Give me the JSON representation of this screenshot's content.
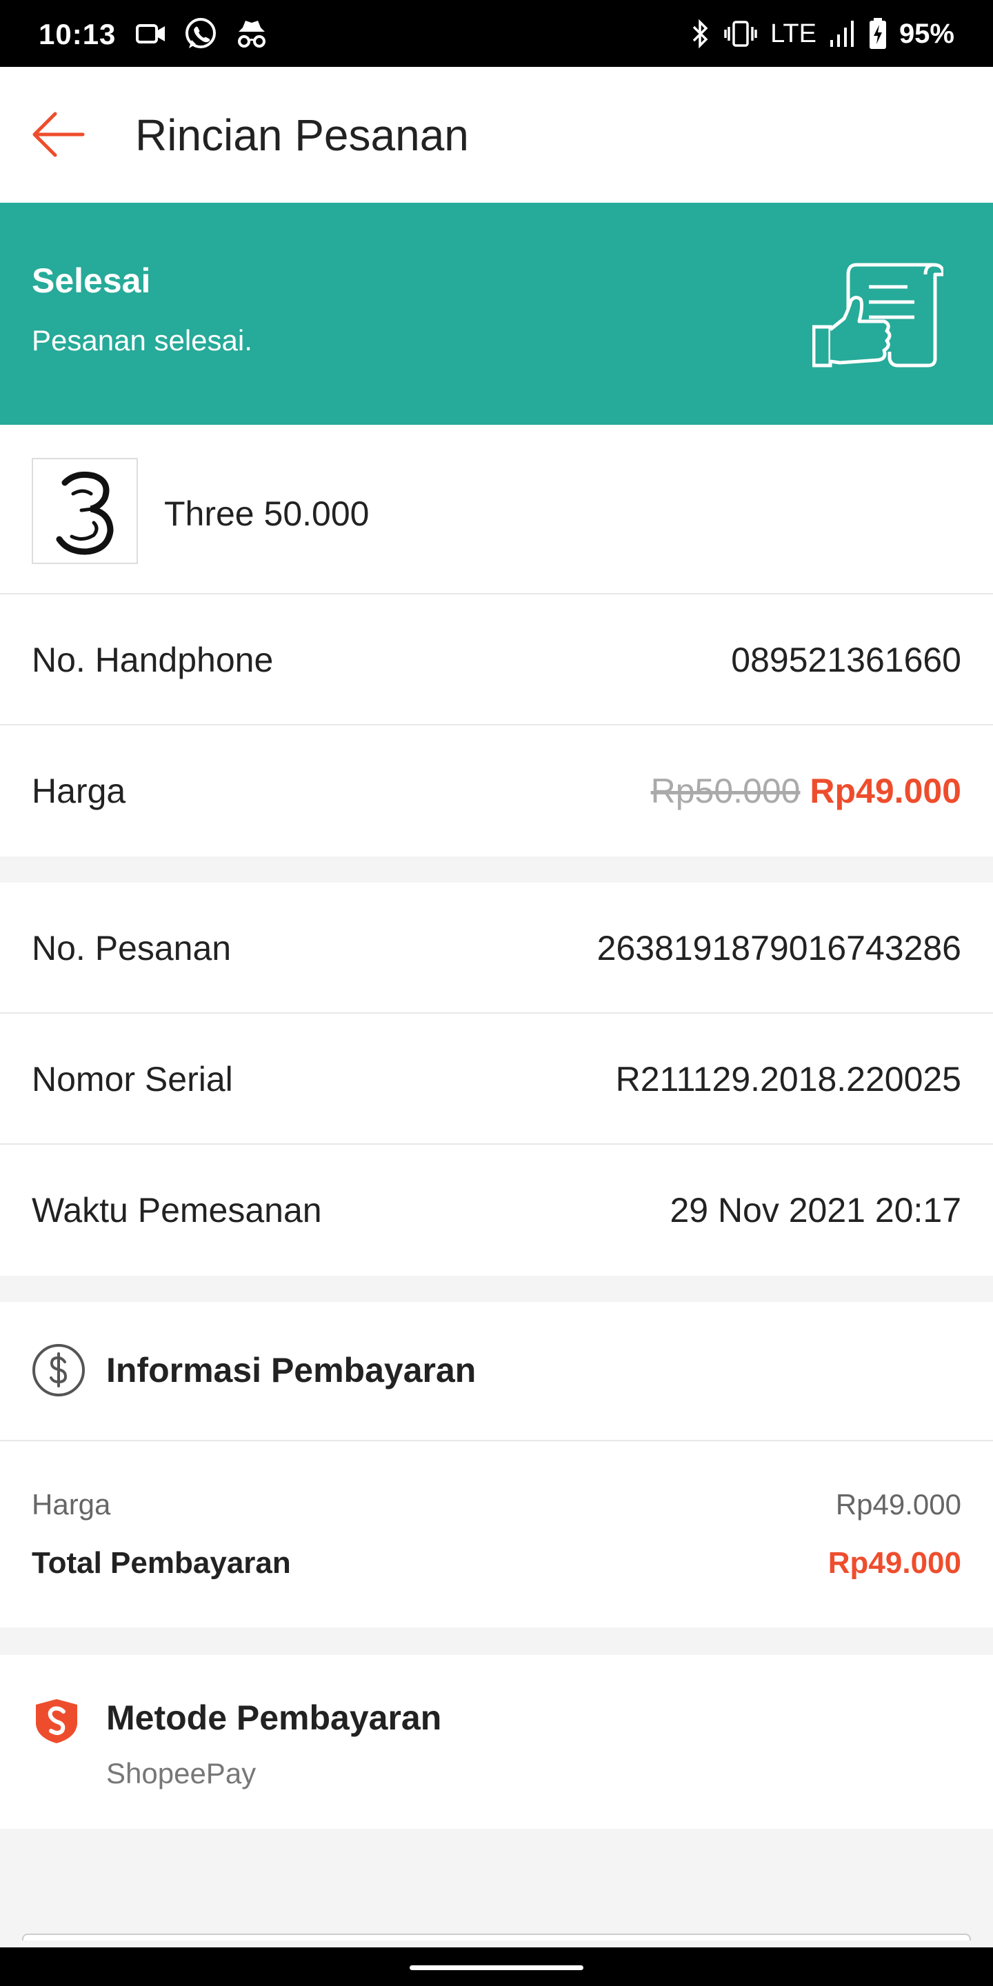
{
  "status_bar": {
    "time": "10:13",
    "left_icons": [
      "video-camera-icon",
      "whatsapp-icon",
      "incognito-icon"
    ],
    "right_icons": [
      "bluetooth-icon",
      "vibrate-icon",
      "signal-icon",
      "battery-charging-icon"
    ],
    "network": "LTE",
    "battery": "95%"
  },
  "header": {
    "title": "Rincian Pesanan",
    "back_icon": "arrow-left-icon"
  },
  "order_status": {
    "title": "Selesai",
    "subtitle": "Pesanan selesai.",
    "icon": "receipt-thumbs-up-icon",
    "color": "#26aa99"
  },
  "product": {
    "name": "Three 50.000",
    "logo_icon": "three-logo-icon"
  },
  "details": {
    "phone_label": "No. Handphone",
    "phone_value": "089521361660",
    "price_label": "Harga",
    "price_original": "Rp50.000",
    "price_final": "Rp49.000"
  },
  "order_info": {
    "order_no_label": "No. Pesanan",
    "order_no_value": "2638191879016743286",
    "serial_label": "Nomor Serial",
    "serial_value": "R211129.2018.220025",
    "time_label": "Waktu Pemesanan",
    "time_value": "29 Nov 2021 20:17"
  },
  "payment_info": {
    "title": "Informasi Pembayaran",
    "icon": "dollar-circle-icon",
    "price_label": "Harga",
    "price_value": "Rp49.000",
    "total_label": "Total Pembayaran",
    "total_value": "Rp49.000"
  },
  "payment_method": {
    "title": "Metode Pembayaran",
    "value": "ShopeePay",
    "icon": "shopee-shield-icon"
  },
  "colors": {
    "accent": "#ee4d2d",
    "banner": "#26aa99"
  }
}
